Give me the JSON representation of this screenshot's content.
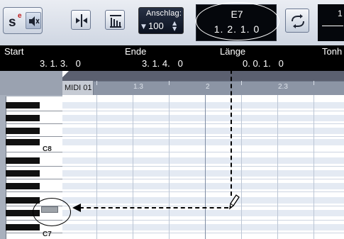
{
  "toolbar": {
    "solo_label": "s",
    "edit_solo_label": "e",
    "velocity_label": "Anschlag:",
    "velocity_value": "100",
    "mouse_note_name": "E7",
    "mouse_position": "1. 2. 1.   0",
    "right_display_top": "1",
    "right_display_bottom": ""
  },
  "info_line": {
    "start_label": "Start",
    "start_value": "3. 1. 3.   0",
    "end_label": "Ende",
    "end_value": "3. 1. 4.   0",
    "length_label": "Länge",
    "length_value": "0. 0. 1.   0",
    "pitch_label": "Tonh"
  },
  "ruler": {
    "track_name": "MIDI 01",
    "labels": [
      "1.3",
      "2",
      "2.3"
    ]
  },
  "keyboard": {
    "labels": [
      "C8",
      "C7"
    ]
  },
  "icons": {
    "solo": "solo-icon",
    "speaker": "speaker-icon",
    "insert": "insert-velocity-icon",
    "quantize": "quantize-icon",
    "loop": "loop-icon",
    "pencil": "pencil-icon"
  },
  "colors": {
    "grid_row_light": "#e4eaf3",
    "info_bg": "#000000",
    "ruler_bg": "#7f8898"
  }
}
